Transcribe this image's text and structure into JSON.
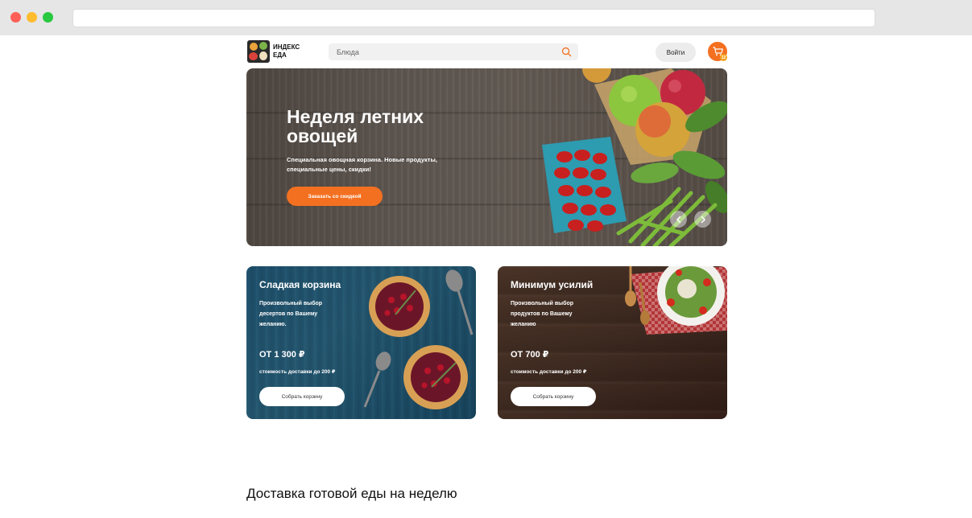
{
  "header": {
    "logo_line1": "ИНДЕКС",
    "logo_line2": "ЕДА",
    "search_placeholder": "Блюда",
    "login_label": "Войти",
    "cart_count": "12"
  },
  "hero": {
    "title": "Неделя летних овощей",
    "subtitle": "Специальная овощная корзина. Новые продукты, специальные цены, скидки!",
    "button_label": "Заказать со скидкой"
  },
  "cards": [
    {
      "title": "Сладкая корзина",
      "description": "Произвольный выбор десертов по Вашему желанию.",
      "price": "ОТ 1 300 ₽",
      "delivery": "стоимость доставки до 200 ₽",
      "button_label": "Собрать корзину"
    },
    {
      "title": "Минимум усилий",
      "description": "Произвольный выбор продуктов по Вашему желанию",
      "price": "ОТ 700 ₽",
      "delivery": "стоимость доставки до 200 ₽",
      "button_label": "Собрать корзину"
    }
  ],
  "section_title": "Доставка готовой еды на неделю",
  "colors": {
    "accent": "#f37021",
    "badge": "#f6a21d"
  },
  "icons": [
    "search-icon",
    "cart-icon",
    "chevron-left-icon",
    "chevron-right-icon"
  ]
}
